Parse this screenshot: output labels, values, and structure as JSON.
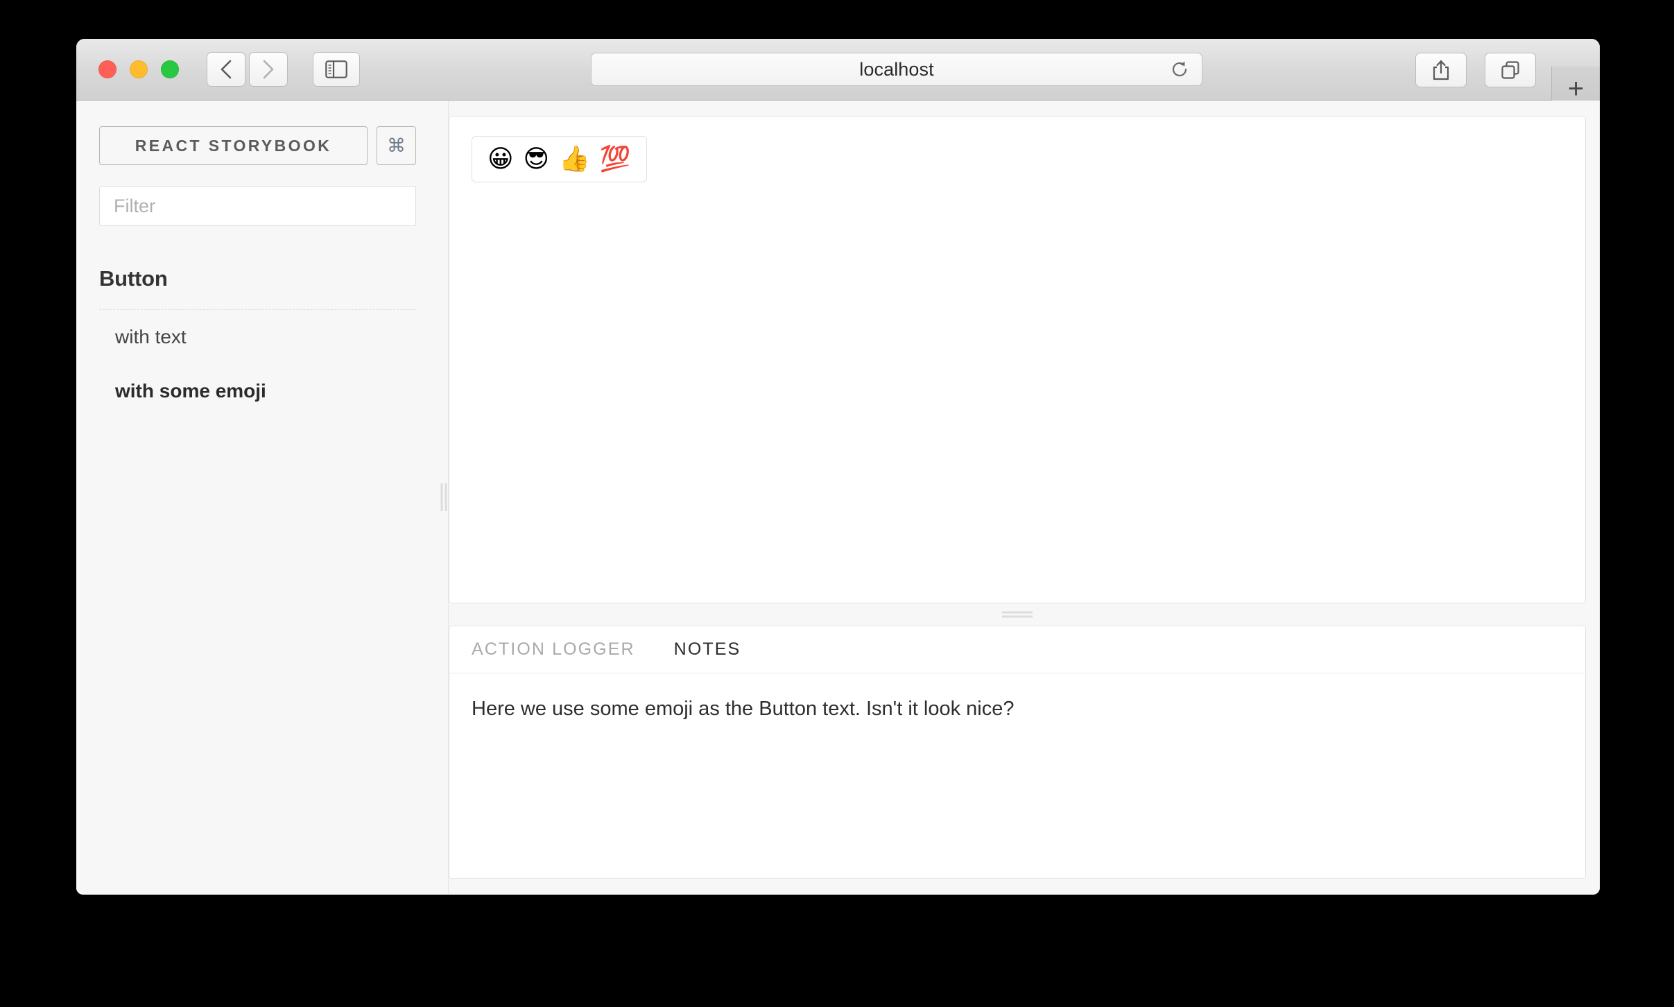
{
  "browser": {
    "address_value": "localhost",
    "traffic_lights": [
      "close",
      "minimize",
      "maximize"
    ],
    "back_icon": "chevron-left-icon",
    "forward_icon": "chevron-right-icon",
    "sidebar_icon": "sidebar-toggle-icon",
    "reload_icon": "reload-icon",
    "share_icon": "share-icon",
    "tabs_icon": "show-tabs-icon",
    "new_tab_label": "+"
  },
  "sidebar": {
    "brand_label": "REACT STORYBOOK",
    "shortcut_label": "⌘",
    "filter": {
      "placeholder": "Filter",
      "value": ""
    },
    "kinds": [
      {
        "name": "Button",
        "stories": [
          {
            "label": "with text",
            "selected": false
          },
          {
            "label": "with some emoji",
            "selected": true
          }
        ]
      }
    ]
  },
  "preview": {
    "button": {
      "emojis": [
        "😀",
        "😎",
        "👍",
        "💯"
      ]
    }
  },
  "panel": {
    "tabs": [
      {
        "label": "ACTION LOGGER",
        "active": false
      },
      {
        "label": "NOTES",
        "active": true
      }
    ],
    "notes_text": "Here we use some emoji as the Button text. Isn't it look nice?"
  },
  "colors": {
    "window_chrome": "#d8d8d8",
    "sidebar_bg": "#f7f7f7",
    "panel_bg": "#ffffff",
    "text_primary": "#2b2b2b",
    "text_muted": "#a9a9a9",
    "border": "#e4e4e4"
  }
}
